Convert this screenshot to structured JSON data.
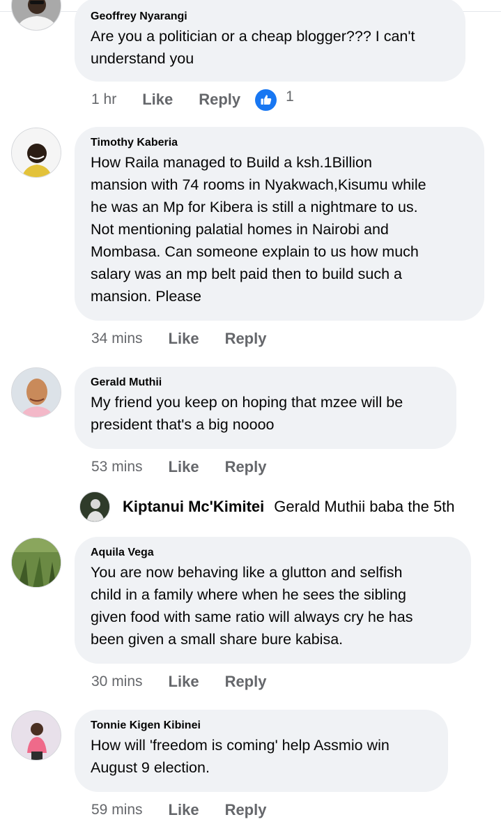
{
  "comments": [
    {
      "name": "Geoffrey Nyarangi",
      "lines": [
        "Are you a politician or a cheap blogger??? I can't",
        "understand you"
      ],
      "time": "1 hr",
      "like": "Like",
      "reply": "Reply",
      "reaction_count": "1",
      "reaction_icon": "like-thumbs-up-icon"
    },
    {
      "name": "Timothy Kaberia",
      "lines": [
        "How Raila managed to Build a ksh.1Billion",
        "mansion with 74 rooms in Nyakwach,Kisumu while",
        "he was an Mp for Kibera is still a nightmare to us.",
        "Not mentioning palatial homes in Nairobi and",
        "Mombasa. Can someone explain to us how much",
        "salary was an mp belt paid then to build such a",
        "mansion. Please"
      ],
      "time": "34 mins",
      "like": "Like",
      "reply": "Reply"
    },
    {
      "name": "Gerald Muthii",
      "lines": [
        "My friend you keep on hoping that mzee will be",
        "president that's a big noooo"
      ],
      "time": "53 mins",
      "like": "Like",
      "reply": "Reply"
    },
    {
      "name": "Aquila Vega",
      "lines": [
        "You are now behaving like a glutton and selfish",
        "child in a family where when he sees the sibling",
        "given food with same ratio will always cry he has",
        "been given a small share bure kabisa."
      ],
      "time": "30 mins",
      "like": "Like",
      "reply": "Reply"
    },
    {
      "name": "Tonnie Kigen Kibinei",
      "lines": [
        "How will 'freedom is coming' help Assmio win",
        "August 9 election."
      ],
      "time": "59 mins",
      "like": "Like",
      "reply": "Reply"
    }
  ],
  "reply_preview": {
    "name": "Kiptanui Mc'Kimitei",
    "text": "Gerald Muthii baba the 5th"
  },
  "colors": {
    "bubble": "#f0f2f5",
    "meta_text": "#65676b",
    "like_reaction": "#1877f2"
  }
}
